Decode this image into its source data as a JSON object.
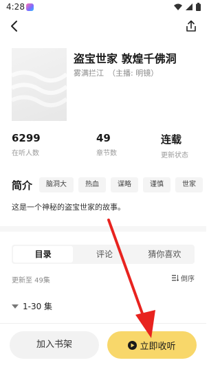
{
  "status": {
    "time": "4:28",
    "icons": [
      "app-icon",
      "wifi-icon",
      "signal-icon",
      "battery-icon"
    ]
  },
  "header": {
    "back_icon": "back-icon",
    "share_icon": "share-icon"
  },
  "book": {
    "title": "盗宝世家 敦煌千佛洞",
    "author": "雾满拦江",
    "narrator": "（主播: 明镜）"
  },
  "stats": [
    {
      "value": "6299",
      "label": "在听人数"
    },
    {
      "value": "49",
      "label": "章节数"
    },
    {
      "value": "连载",
      "label": "更新状态"
    }
  ],
  "intro": {
    "label": "简介",
    "tags": [
      "脑洞大",
      "热血",
      "谋略",
      "谨慎",
      "世家"
    ],
    "text": "这是一个神秘的盗宝世家的故事。"
  },
  "tabs": [
    {
      "label": "目录",
      "active": true
    },
    {
      "label": "评论",
      "active": false
    },
    {
      "label": "猜你喜欢",
      "active": false
    }
  ],
  "catalog": {
    "update_info": "更新至 49集",
    "sort_label": "倒序",
    "range_label": "1-30 集"
  },
  "bottom": {
    "shelf_label": "加入书架",
    "listen_label": "立即收听"
  },
  "colors": {
    "accent_button": "#f8d76a",
    "annotation_arrow": "#e8231f"
  }
}
